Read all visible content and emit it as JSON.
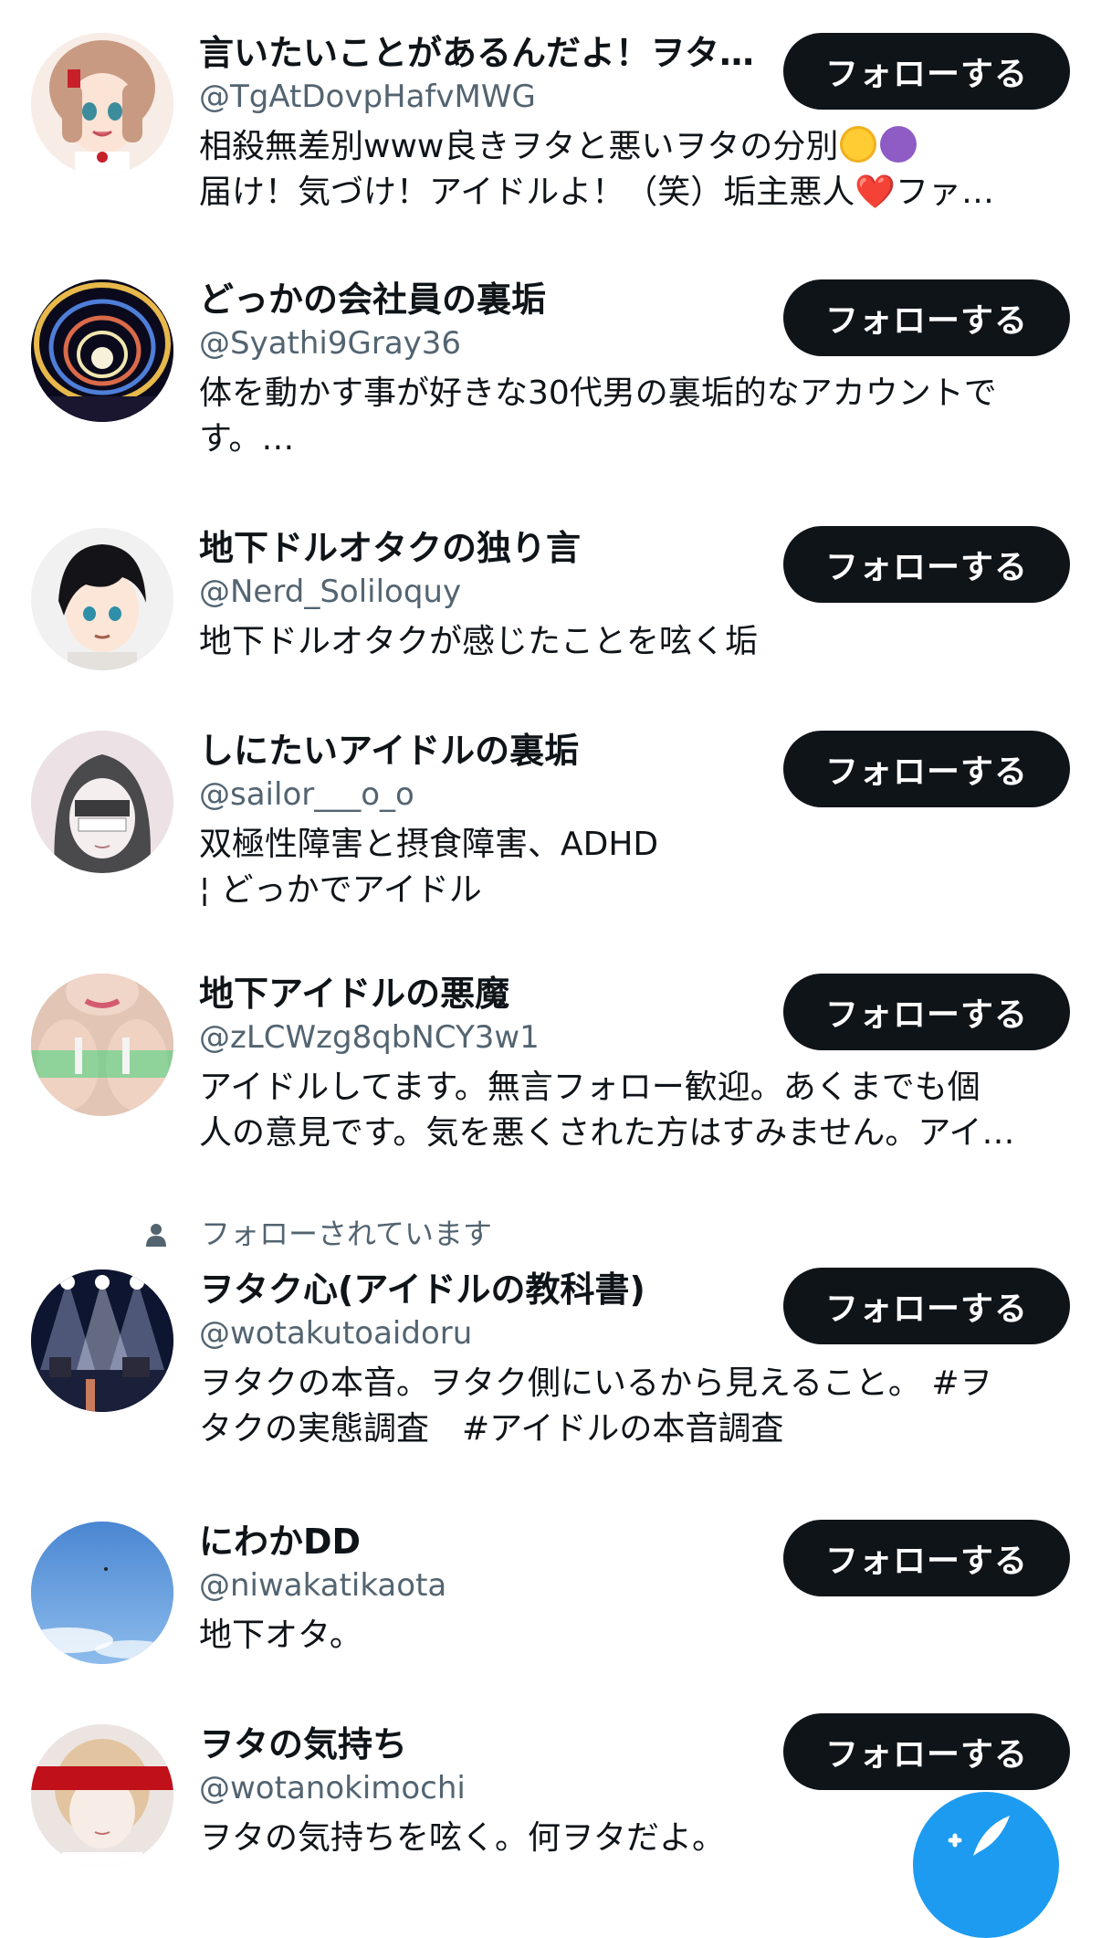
{
  "follow_label": "フォローする",
  "users": [
    {
      "display_name": "言いたいことがあるんだよ！ヲタ…",
      "handle": "@TgAtDovpHafvMWG",
      "bio_lines": [
        "相殺無差別www良きヲタと悪いヲタの分別",
        "届け！気づけ！アイドルよ！（笑）垢主悪人❤️ファ…"
      ],
      "avatar_icon": "anime-girl-avatar"
    },
    {
      "display_name": "どっかの会社員の裏垢",
      "handle": "@Syathi9Gray36",
      "bio_lines": [
        "体を動かす事が好きな30代男の裏垢的なアカウントで",
        "す。…"
      ],
      "avatar_icon": "illumination-avatar"
    },
    {
      "display_name": "地下ドルオタクの独り言",
      "handle": "@Nerd_Soliloquy",
      "bio_lines": [
        "地下ドルオタクが感じたことを呟く垢"
      ],
      "avatar_icon": "anime-boy-avatar"
    },
    {
      "display_name": "しにたいアイドルの裏垢",
      "handle": "@sailor___o_o",
      "bio_lines": [
        "双極性障害と摂食障害、ADHD",
        "¦ どっかでアイドル"
      ],
      "avatar_icon": "sketch-girl-avatar"
    },
    {
      "display_name": "地下アイドルの悪魔",
      "handle": "@zLCWzg8qbNCY3w1",
      "bio_lines": [
        "アイドルしてます。無言フォロー歓迎。あくまでも個",
        "人の意見です。気を悪くされた方はすみません。アイ…"
      ],
      "avatar_icon": "hands-photo-avatar"
    },
    {
      "social_context": "フォローされています",
      "display_name": "ヲタク心(アイドルの教科書)",
      "handle": "@wotakutoaidoru",
      "bio_lines": [
        "ヲタクの本音。ヲタク側にいるから見えること。 #ヲ",
        "タクの実態調査　#アイドルの本音調査"
      ],
      "avatar_icon": "stage-lights-avatar"
    },
    {
      "display_name": "にわかDD",
      "handle": "@niwakatikaota",
      "bio_lines": [
        "地下オタ。"
      ],
      "avatar_icon": "sky-avatar"
    },
    {
      "display_name": "ヲタの気持ち",
      "handle": "@wotanokimochi",
      "bio_lines": [
        "ヲタの気持ちを呟く。何ヲタだよ。"
      ],
      "avatar_icon": "masked-face-avatar"
    }
  ],
  "emoji": {
    "halo_face": "smiling-face-with-halo-emoji",
    "devil_face": "smiling-devil-emoji"
  },
  "fab_icon": "compose-feather-icon",
  "colors": {
    "primary_text": "#0f1419",
    "secondary_text": "#536471",
    "button_bg": "#0f1419",
    "accent_blue": "#1d9bf0"
  }
}
